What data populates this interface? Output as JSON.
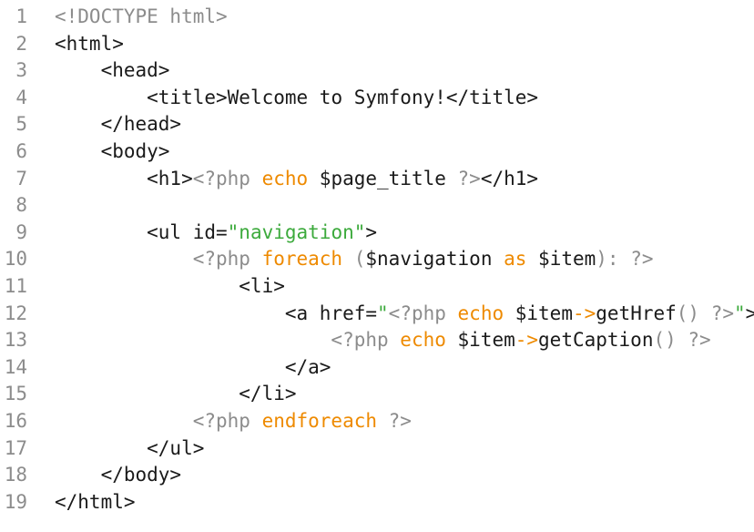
{
  "document": {
    "line_numbers": [
      "1",
      "2",
      "3",
      "4",
      "5",
      "6",
      "7",
      "8",
      "9",
      "10",
      "11",
      "12",
      "13",
      "14",
      "15",
      "16",
      "17",
      "18",
      "19"
    ],
    "lines": [
      [
        {
          "t": "<!DOCTYPE html>",
          "c": "gray"
        }
      ],
      [
        {
          "t": "<html>",
          "c": "dark"
        }
      ],
      [
        {
          "t": "    <head>",
          "c": "dark"
        }
      ],
      [
        {
          "t": "        <title>",
          "c": "dark"
        },
        {
          "t": "Welcome to Symfony!",
          "c": "dark"
        },
        {
          "t": "</title>",
          "c": "dark"
        }
      ],
      [
        {
          "t": "    </head>",
          "c": "dark"
        }
      ],
      [
        {
          "t": "    <body>",
          "c": "dark"
        }
      ],
      [
        {
          "t": "        <h1>",
          "c": "dark"
        },
        {
          "t": "<?php ",
          "c": "gray"
        },
        {
          "t": "echo",
          "c": "orange"
        },
        {
          "t": " $page_title ",
          "c": "dark"
        },
        {
          "t": "?>",
          "c": "gray"
        },
        {
          "t": "</h1>",
          "c": "dark"
        }
      ],
      [],
      [
        {
          "t": "        <ul ",
          "c": "dark"
        },
        {
          "t": "id=",
          "c": "dark"
        },
        {
          "t": "\"navigation\"",
          "c": "green"
        },
        {
          "t": ">",
          "c": "dark"
        }
      ],
      [
        {
          "t": "            <?php ",
          "c": "gray"
        },
        {
          "t": "foreach",
          "c": "orange"
        },
        {
          "t": " (",
          "c": "gray"
        },
        {
          "t": "$navigation",
          "c": "dark"
        },
        {
          "t": " as ",
          "c": "orange"
        },
        {
          "t": "$item",
          "c": "dark"
        },
        {
          "t": "): ?>",
          "c": "gray"
        }
      ],
      [
        {
          "t": "                <li>",
          "c": "dark"
        }
      ],
      [
        {
          "t": "                    <a ",
          "c": "dark"
        },
        {
          "t": "href=",
          "c": "dark"
        },
        {
          "t": "\"",
          "c": "green"
        },
        {
          "t": "<?php ",
          "c": "gray"
        },
        {
          "t": "echo",
          "c": "orange"
        },
        {
          "t": " $item",
          "c": "dark"
        },
        {
          "t": "->",
          "c": "orange"
        },
        {
          "t": "getHref",
          "c": "dark"
        },
        {
          "t": "() ?>",
          "c": "gray"
        },
        {
          "t": "\"",
          "c": "green"
        },
        {
          "t": ">",
          "c": "dark"
        }
      ],
      [
        {
          "t": "                        <?php ",
          "c": "gray"
        },
        {
          "t": "echo",
          "c": "orange"
        },
        {
          "t": " $item",
          "c": "dark"
        },
        {
          "t": "->",
          "c": "orange"
        },
        {
          "t": "getCaption",
          "c": "dark"
        },
        {
          "t": "() ?>",
          "c": "gray"
        }
      ],
      [
        {
          "t": "                    </a>",
          "c": "dark"
        }
      ],
      [
        {
          "t": "                </li>",
          "c": "dark"
        }
      ],
      [
        {
          "t": "            <?php ",
          "c": "gray"
        },
        {
          "t": "endforeach",
          "c": "orange"
        },
        {
          "t": " ?>",
          "c": "gray"
        }
      ],
      [
        {
          "t": "        </ul>",
          "c": "dark"
        }
      ],
      [
        {
          "t": "    </body>",
          "c": "dark"
        }
      ],
      [
        {
          "t": "</html>",
          "c": "dark"
        }
      ]
    ],
    "colors": {
      "gray": "#8c8c8c",
      "orange": "#ee8a00",
      "green": "#3caa3c",
      "dark": "#1a1a1a",
      "background": "#ffffff"
    }
  }
}
